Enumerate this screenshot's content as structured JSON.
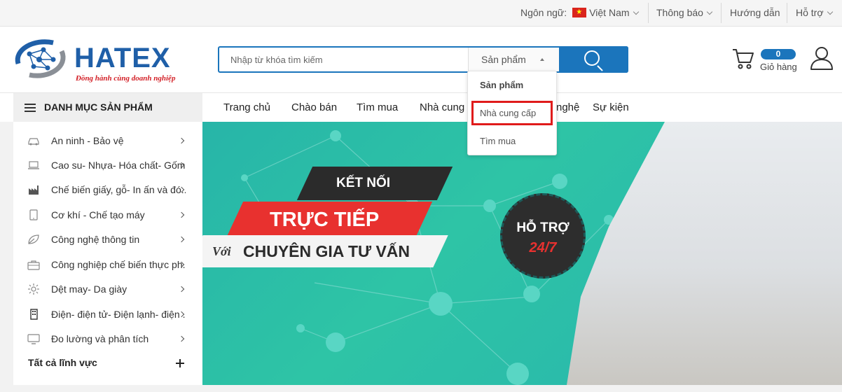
{
  "topbar": {
    "language_label": "Ngôn ngữ:",
    "language_value": "Việt Nam",
    "notifications": "Thông báo",
    "guide": "Hướng dẫn",
    "support": "Hỗ trợ"
  },
  "logo": {
    "name": "HATEX",
    "tagline": "Đồng hành cùng doanh nghiệp"
  },
  "search": {
    "placeholder": "Nhập từ khóa tìm kiếm",
    "category_selected": "Sản phẩm",
    "dropdown_options": [
      "Sản phẩm",
      "Nhà cung cấp",
      "Tìm mua"
    ]
  },
  "cart": {
    "count": "0",
    "label": "Giỏ hàng"
  },
  "nav": {
    "category_button": "DANH MỤC SẢN PHẨM",
    "links": [
      "Trang chủ",
      "Chào bán",
      "Tìm mua",
      "Nhà cung",
      "nghệ",
      "Sự kiện"
    ]
  },
  "sidebar": {
    "items": [
      {
        "label": "An ninh - Bảo vệ",
        "icon": "car-icon"
      },
      {
        "label": "Cao su- Nhựa- Hóa chất- Gốm",
        "icon": "laptop-icon"
      },
      {
        "label": "Chế biến giấy, gỗ- In ấn và đó...",
        "icon": "factory-icon"
      },
      {
        "label": "Cơ khí - Chế tạo máy",
        "icon": "tablet-icon"
      },
      {
        "label": "Công nghệ thông tin",
        "icon": "leaf-icon"
      },
      {
        "label": "Công nghiệp chế biến thực ph...",
        "icon": "briefcase-icon"
      },
      {
        "label": "Dệt may- Da giày",
        "icon": "sun-icon"
      },
      {
        "label": "Điện- điện tử- Điện lạnh- điện ...",
        "icon": "building-icon"
      },
      {
        "label": "Đo lường và phân tích",
        "icon": "monitor-icon"
      }
    ],
    "all_label": "Tất cả lĩnh vực"
  },
  "banner": {
    "line1": "KẾT NỐI",
    "line2": "TRỰC TIẾP",
    "line3_prefix": "Với",
    "line3": "CHUYÊN GIA TƯ VẤN",
    "support_line1": "HỖ TRỢ",
    "support_line2": "24/7"
  },
  "colors": {
    "brand": "#1b75bc",
    "accent_red": "#e8312f",
    "banner_teal": "#2ec4a6"
  }
}
